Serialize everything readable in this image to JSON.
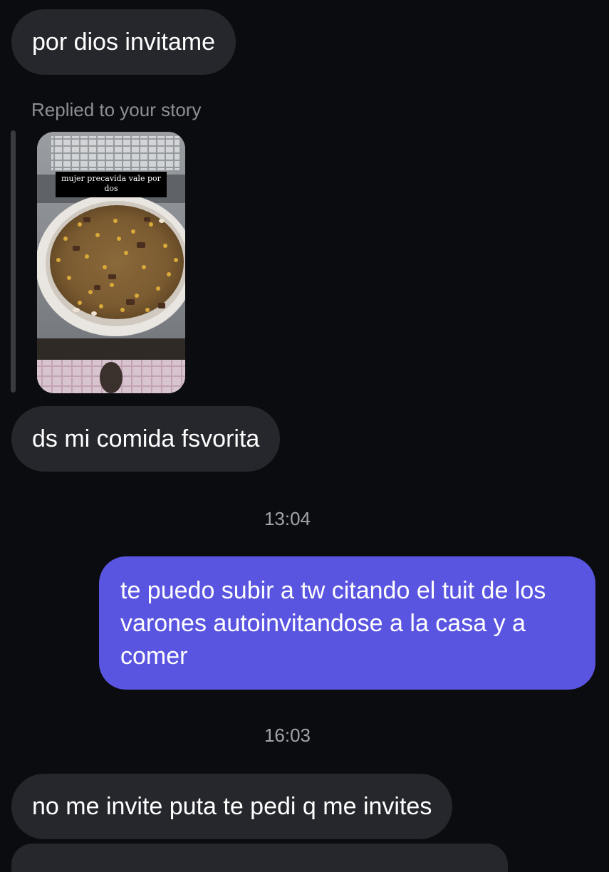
{
  "messages": {
    "m1": "por dios invitame",
    "reply_label": "Replied to your story",
    "story_caption": "mujer precavida vale por dos",
    "m2": "ds mi comida fsvorita",
    "time1": "13:04",
    "m3": "te puedo subir a tw citando el tuit de los varones autoinvitandose a la casa y a comer",
    "time2": "16:03",
    "m4": "no me invite puta te pedi q me invites"
  },
  "colors": {
    "background": "#0b0c10",
    "incoming_bubble": "#26272c",
    "outgoing_bubble": "#5a55e0",
    "muted_text": "#8e8f94"
  }
}
